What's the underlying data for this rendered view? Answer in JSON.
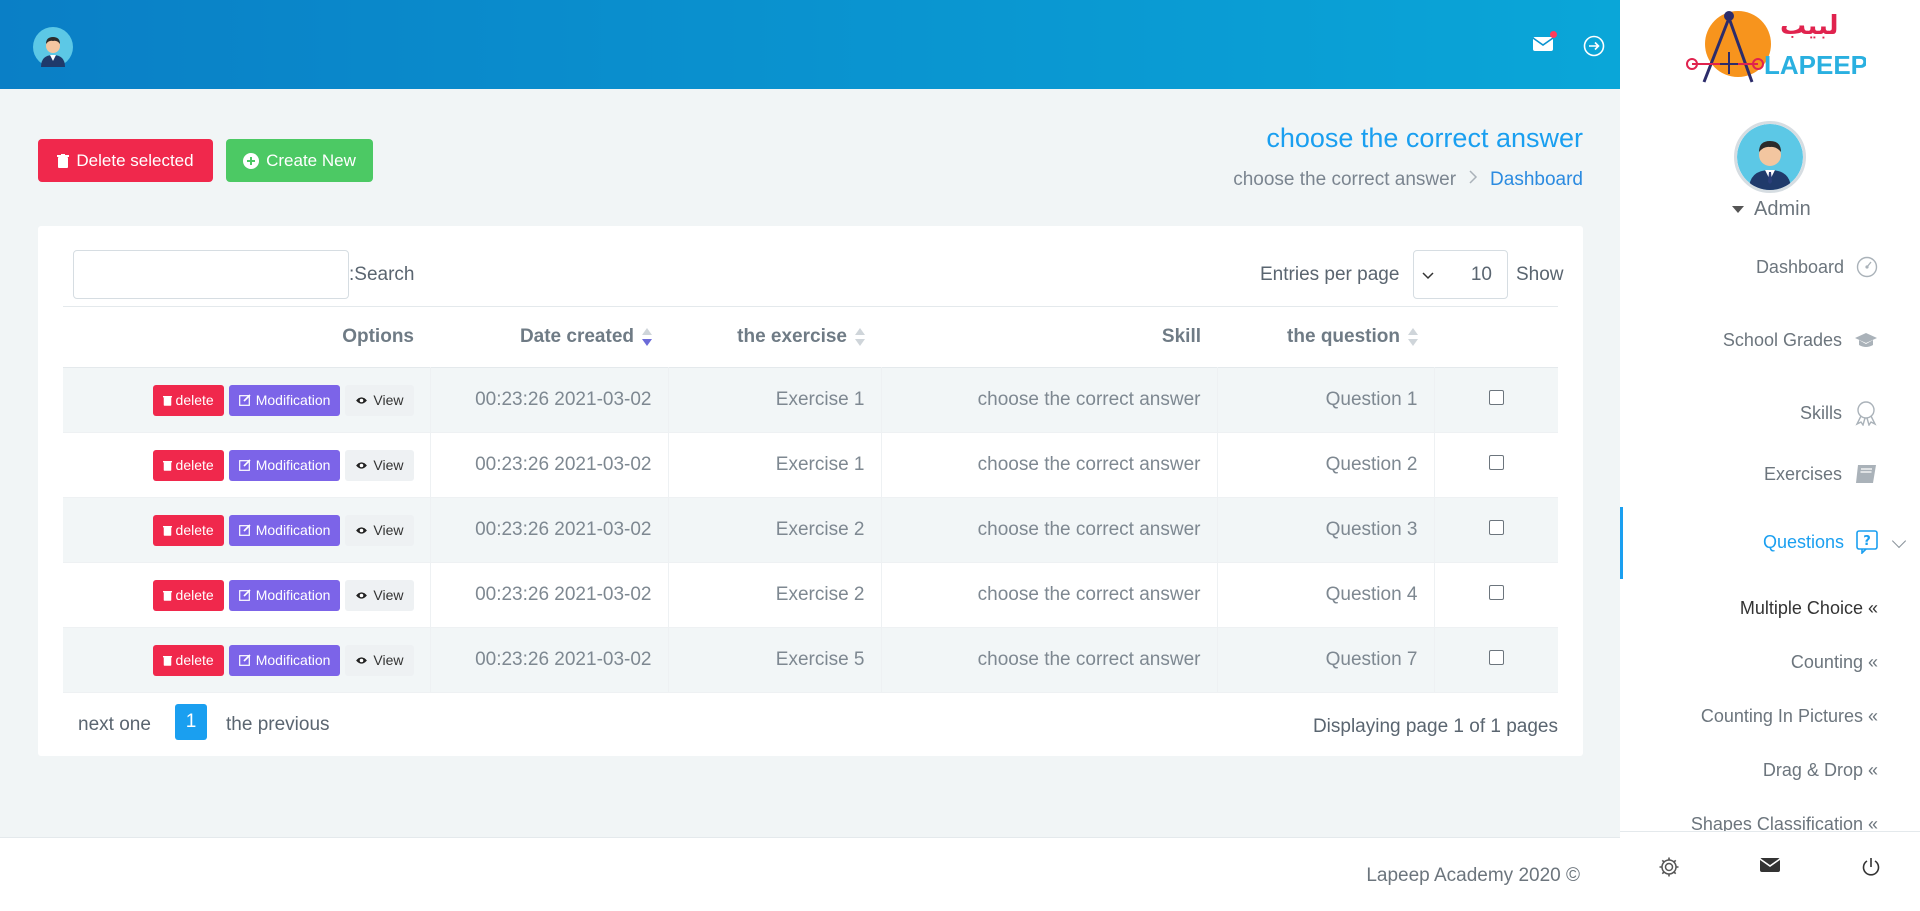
{
  "header": {
    "mail_icon": "mail-icon",
    "logout_icon": "logout-icon"
  },
  "toolbar": {
    "delete_selected": "Delete selected",
    "create_new": "Create New"
  },
  "page": {
    "title": "choose the correct answer",
    "breadcrumb_current": "choose the correct answer",
    "breadcrumb_link": "Dashboard"
  },
  "table_controls": {
    "search_label": ":Search",
    "search_value": "",
    "entries_label": "Entries per page",
    "entries_value": "10",
    "show_label": "Show"
  },
  "table": {
    "columns": {
      "options": "Options",
      "date_created": "Date created",
      "exercise": "the exercise",
      "skill": "Skill",
      "question": "the question"
    },
    "row_buttons": {
      "delete": "delete",
      "modification": "Modification",
      "view": "View"
    },
    "rows": [
      {
        "date": "00:23:26 2021-03-02",
        "exercise": "Exercise 1",
        "skill": "choose the correct answer",
        "question": "Question 1"
      },
      {
        "date": "00:23:26 2021-03-02",
        "exercise": "Exercise 1",
        "skill": "choose the correct answer",
        "question": "Question 2"
      },
      {
        "date": "00:23:26 2021-03-02",
        "exercise": "Exercise 2",
        "skill": "choose the correct answer",
        "question": "Question 3"
      },
      {
        "date": "00:23:26 2021-03-02",
        "exercise": "Exercise 2",
        "skill": "choose the correct answer",
        "question": "Question 4"
      },
      {
        "date": "00:23:26 2021-03-02",
        "exercise": "Exercise 5",
        "skill": "choose the correct answer",
        "question": "Question 7"
      }
    ]
  },
  "pagination": {
    "next": "next one",
    "current_page": "1",
    "previous": "the previous",
    "info": "Displaying page 1 of 1 pages"
  },
  "footer": {
    "text": "Lapeep Academy 2020 ©"
  },
  "sidebar": {
    "logo_arabic": "لبيب",
    "logo_latin": "LAPEEP",
    "user": "Admin",
    "nav": {
      "dashboard": "Dashboard",
      "school_grades": "School Grades",
      "skills": "Skills",
      "exercises": "Exercises",
      "questions": "Questions"
    },
    "sub": {
      "multiple_choice": "Multiple Choice",
      "counting": "Counting",
      "counting_pictures": "Counting In Pictures",
      "drag_drop": "Drag & Drop",
      "shapes": "Shapes Classification"
    },
    "sub_marker": "«"
  },
  "colors": {
    "accent": "#1a9ff0",
    "danger": "#f0284c",
    "success": "#4cc964",
    "modify": "#7c64e8"
  }
}
